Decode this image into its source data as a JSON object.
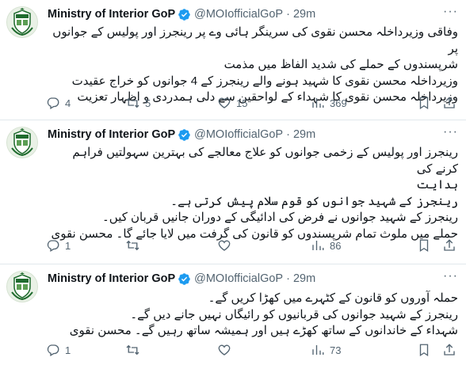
{
  "tweets": [
    {
      "author": {
        "name": "Ministry of Interior GoP",
        "handle": "@MOIofficialGoP",
        "verified": true
      },
      "time": "29m",
      "lines": [
        "وفاقی وزیرداخلہ محسن نقوی کی سرینگر ہائی وے پر رینجرز اور پولیس کے جوانوں پر",
        "شرپسندوں کے حملے کی شدید الفاظ میں مذمت",
        "وزیرداخلہ محسن نقوی کا شہید ہونے والے رینجرز کے 4 جوانوں کو خراج عقیدت",
        "وزیرداخلہ محسن نقوی کا شہداء کے لواحقین سے دلی ہمدردی و اظہار تعزیت"
      ],
      "stats": {
        "replies": "4",
        "retweets": "5",
        "likes": "15",
        "views": "369"
      }
    },
    {
      "author": {
        "name": "Ministry of Interior GoP",
        "handle": "@MOIofficialGoP",
        "verified": true
      },
      "time": "29m",
      "lines": [
        "رینجرز اور پولیس کے زخمی جوانوں کو علاج معالجے کی بہترین سہولتیں فراہم کرنے کی",
        "ہدایت",
        "رینجرز کے شہید جوانوں کو قوم سلام پیش کرتی ہے۔",
        "رینجرز کے شہید جوانوں نے فرض کی ادائیگی کے دوران جانیں قربان کیں۔",
        "حملے میں ملوث تمام شرپسندوں کو قانون کی گرفت میں لایا جائے گا۔ محسن نقوی"
      ],
      "stats": {
        "replies": "1",
        "retweets": "",
        "likes": "",
        "views": "86"
      }
    },
    {
      "author": {
        "name": "Ministry of Interior GoP",
        "handle": "@MOIofficialGoP",
        "verified": true
      },
      "time": "29m",
      "lines": [
        "حملہ آوروں کو قانون کے کٹہرے میں کھڑا کریں گے۔",
        "رینجرز کے شہید جوانوں کی قربانیوں کو رائیگاں نہیں جانے دیں گے۔",
        "شہداء کے خاندانوں کے ساتھ کھڑے ہیں اور ہمیشہ ساتھ رہیں گے۔ محسن نقوی"
      ],
      "stats": {
        "replies": "1",
        "retweets": "",
        "likes": "",
        "views": "73"
      }
    }
  ],
  "colors": {
    "verified": "#1d9bf0",
    "meta": "#536471",
    "divider": "#e1e8ed",
    "emblem_green": "#1f6b2e"
  },
  "icons": [
    "pakistan-emblem-icon",
    "verified-badge-icon",
    "more-icon",
    "reply-icon",
    "retweet-icon",
    "like-icon",
    "views-icon",
    "bookmark-icon",
    "share-icon"
  ]
}
